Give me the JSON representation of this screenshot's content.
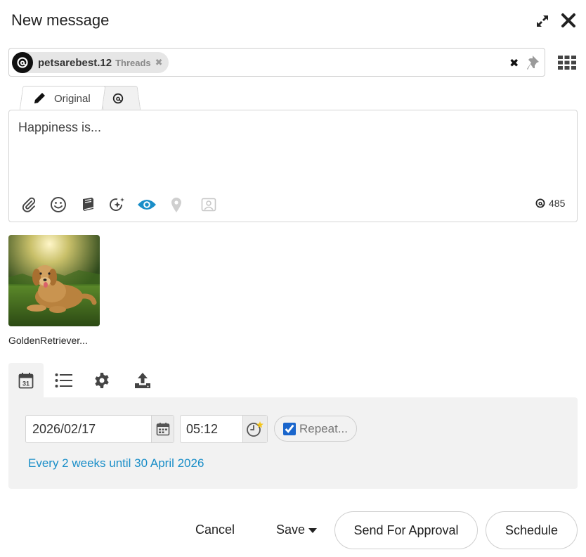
{
  "window": {
    "title": "New message"
  },
  "recipients": {
    "chip": {
      "name": "petsarebest.12",
      "network": "Threads"
    }
  },
  "tabs": {
    "original_label": "Original"
  },
  "composer": {
    "message": "Happiness is...",
    "char_count": "485",
    "preview_active_color": "#1a8ec8"
  },
  "media": {
    "filename": "GoldenRetriever..."
  },
  "schedule": {
    "date": "2026/02/17",
    "time": "05:12",
    "repeat_label": "Repeat...",
    "repeat_checked": true,
    "repeat_summary": "Every 2 weeks until 30 April 2026"
  },
  "footer": {
    "cancel_label": "Cancel",
    "save_label": "Save",
    "approval_label": "Send For Approval",
    "schedule_label": "Schedule"
  }
}
